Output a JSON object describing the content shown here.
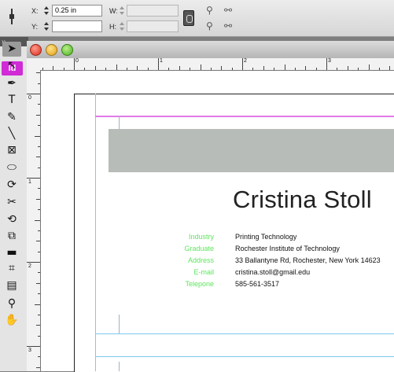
{
  "control_panel": {
    "x_label": "X:",
    "x_value": "0.25 in",
    "y_label": "Y:",
    "y_value": "",
    "w_label": "W:",
    "w_value": "",
    "h_label": "H:",
    "h_value": ""
  },
  "app": {
    "logo": "Id"
  },
  "ruler": {
    "h_numbers": [
      "0",
      "1",
      "2",
      "3"
    ],
    "v_numbers": [
      "0",
      "1",
      "2",
      "3"
    ]
  },
  "tools": [
    {
      "icon": "selection-tool-icon",
      "glyph": "➤"
    },
    {
      "icon": "direct-selection-tool-icon",
      "glyph": "↖"
    },
    {
      "icon": "pen-tool-icon",
      "glyph": "✒"
    },
    {
      "icon": "type-tool-icon",
      "glyph": "T"
    },
    {
      "icon": "pencil-tool-icon",
      "glyph": "✎"
    },
    {
      "icon": "line-tool-icon",
      "glyph": "╲"
    },
    {
      "icon": "rectangle-frame-tool-icon",
      "glyph": "⊠"
    },
    {
      "icon": "ellipse-tool-icon",
      "glyph": "⬭"
    },
    {
      "icon": "rotate-tool-icon",
      "glyph": "⟳"
    },
    {
      "icon": "scissors-tool-icon",
      "glyph": "✂"
    },
    {
      "icon": "free-transform-tool-icon",
      "glyph": "⟲"
    },
    {
      "icon": "scale-tool-icon",
      "glyph": "⧉"
    },
    {
      "icon": "gradient-tool-icon",
      "glyph": "▬"
    },
    {
      "icon": "gradient-feather-tool-icon",
      "glyph": "⌗"
    },
    {
      "icon": "note-tool-icon",
      "glyph": "▤"
    },
    {
      "icon": "eyedropper-tool-icon",
      "glyph": "⚲"
    },
    {
      "icon": "hand-tool-icon",
      "glyph": "✋"
    }
  ],
  "document": {
    "name": "Cristina Stoll",
    "details": [
      {
        "label": "Industry",
        "value": "Printing Technology"
      },
      {
        "label": "Graduate",
        "value": "Rochester Institute of Technology"
      },
      {
        "label": "Address",
        "value": "33 Ballantyne Rd, Rochester, New York 14623"
      },
      {
        "label": "E-mail",
        "value": "cristina.stoll@gmail.edu"
      },
      {
        "label": "Telepone",
        "value": "585-561-3517"
      }
    ]
  },
  "colors": {
    "label_green": "#5de65d",
    "banner_gray": "#b7bcb9",
    "margin_magenta": "#e07ae7",
    "guide_cyan": "#7ec8ef"
  }
}
